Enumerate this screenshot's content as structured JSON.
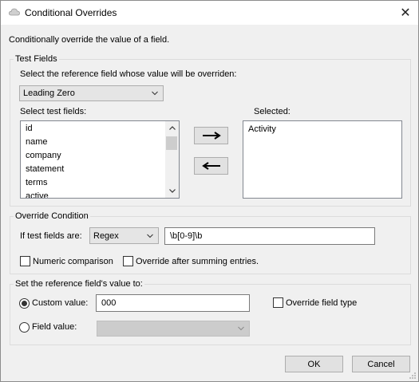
{
  "window": {
    "title": "Conditional Overrides",
    "close_glyph": "✕",
    "description": "Conditionally override the value of a field."
  },
  "test_fields": {
    "group_title": "Test Fields",
    "reference_label": "Select the reference field whose value will be overriden:",
    "reference_value": "Leading Zero",
    "select_label": "Select test fields:",
    "available_fields": [
      "id",
      "name",
      "company",
      "statement",
      "terms",
      "active"
    ],
    "selected_label": "Selected:",
    "selected_fields": [
      "Activity"
    ],
    "add_arrow": "⟶",
    "remove_arrow": "⟵"
  },
  "override_condition": {
    "group_title": "Override Condition",
    "if_label": "If test fields are:",
    "operator_value": "Regex",
    "pattern_value": "\\b[0-9]\\b",
    "numeric_label": "Numeric comparison",
    "numeric_checked": false,
    "summing_label": "Override after summing entries.",
    "summing_checked": false
  },
  "set_value": {
    "group_title": "Set the reference field's value to:",
    "custom_label": "Custom value:",
    "custom_selected": true,
    "custom_value": "000",
    "override_type_label": "Override field type",
    "override_type_checked": false,
    "field_label": "Field value:",
    "field_selected": false,
    "field_value": ""
  },
  "buttons": {
    "ok": "OK",
    "cancel": "Cancel"
  },
  "icons": {
    "title": "cloud-icon",
    "close": "close-icon",
    "dropdown": "chevron-down-icon"
  }
}
